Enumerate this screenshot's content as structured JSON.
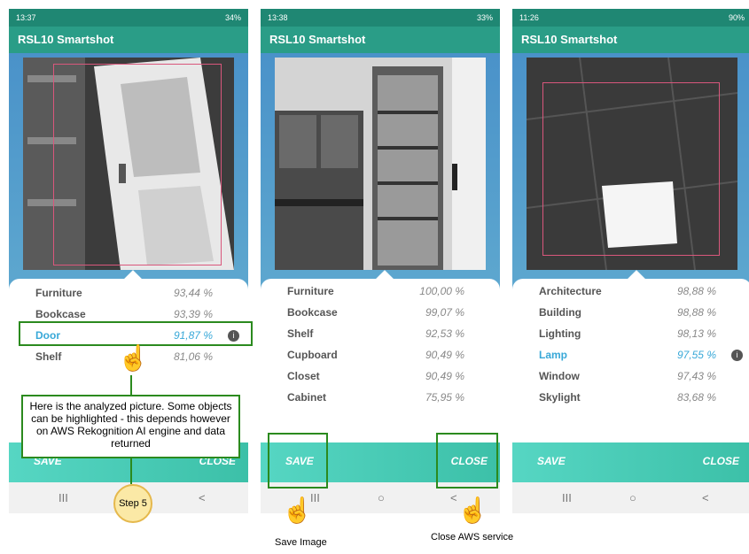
{
  "phones": [
    {
      "status_time": "13:37",
      "status_right": "34%",
      "app_title": "RSL10 Smartshot",
      "results": [
        {
          "label": "Furniture",
          "pct": "93,44 %"
        },
        {
          "label": "Bookcase",
          "pct": "93,39 %"
        },
        {
          "label": "Door",
          "pct": "91,87 %"
        },
        {
          "label": "Shelf",
          "pct": "81,06 %"
        }
      ],
      "save_label": "SAVE",
      "close_label": "CLOSE"
    },
    {
      "status_time": "13:38",
      "status_right": "33%",
      "app_title": "RSL10 Smartshot",
      "results": [
        {
          "label": "Furniture",
          "pct": "100,00 %"
        },
        {
          "label": "Bookcase",
          "pct": "99,07 %"
        },
        {
          "label": "Shelf",
          "pct": "92,53 %"
        },
        {
          "label": "Cupboard",
          "pct": "90,49 %"
        },
        {
          "label": "Closet",
          "pct": "90,49 %"
        },
        {
          "label": "Cabinet",
          "pct": "75,95 %"
        }
      ],
      "save_label": "SAVE",
      "close_label": "CLOSE"
    },
    {
      "status_time": "11:26",
      "status_right": "90%",
      "app_title": "RSL10 Smartshot",
      "results": [
        {
          "label": "Architecture",
          "pct": "98,88 %"
        },
        {
          "label": "Building",
          "pct": "98,88 %"
        },
        {
          "label": "Lighting",
          "pct": "98,13 %"
        },
        {
          "label": "Lamp",
          "pct": "97,55 %"
        },
        {
          "label": "Window",
          "pct": "97,43 %"
        },
        {
          "label": "Skylight",
          "pct": "83,68 %"
        }
      ],
      "save_label": "SAVE",
      "close_label": "CLOSE"
    }
  ],
  "annotations": {
    "callout": "Here is the analyzed picture. Some objects can be highlighted - this depends however on AWS Rekognition AI engine and data returned",
    "step": "Step 5",
    "save_caption": "Save Image",
    "close_caption": "Close AWS service"
  },
  "nav": {
    "recent": "III",
    "home": "○",
    "back": "<"
  }
}
